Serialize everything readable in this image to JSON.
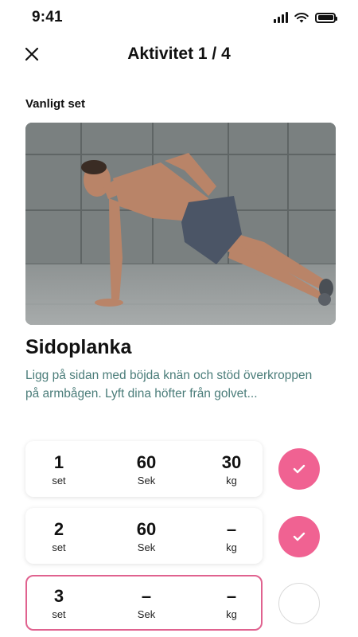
{
  "status": {
    "time": "9:41"
  },
  "nav": {
    "title": "Aktivitet 1 / 4"
  },
  "exercise": {
    "set_type": "Vanligt set",
    "title": "Sidoplanka",
    "description": "Ligg på sidan med böjda knän och stöd överkroppen på armbågen. Lyft dina höfter från golvet..."
  },
  "sets": [
    {
      "number": "1",
      "number_label": "set",
      "duration": "60",
      "duration_label": "Sek",
      "weight": "30",
      "weight_label": "kg",
      "done": true
    },
    {
      "number": "2",
      "number_label": "set",
      "duration": "60",
      "duration_label": "Sek",
      "weight": "–",
      "weight_label": "kg",
      "done": true
    },
    {
      "number": "3",
      "number_label": "set",
      "duration": "–",
      "duration_label": "Sek",
      "weight": "–",
      "weight_label": "kg",
      "done": false
    }
  ],
  "colors": {
    "accent": "#f06292",
    "active_border": "#e0628f",
    "description": "#4b7d7a"
  }
}
